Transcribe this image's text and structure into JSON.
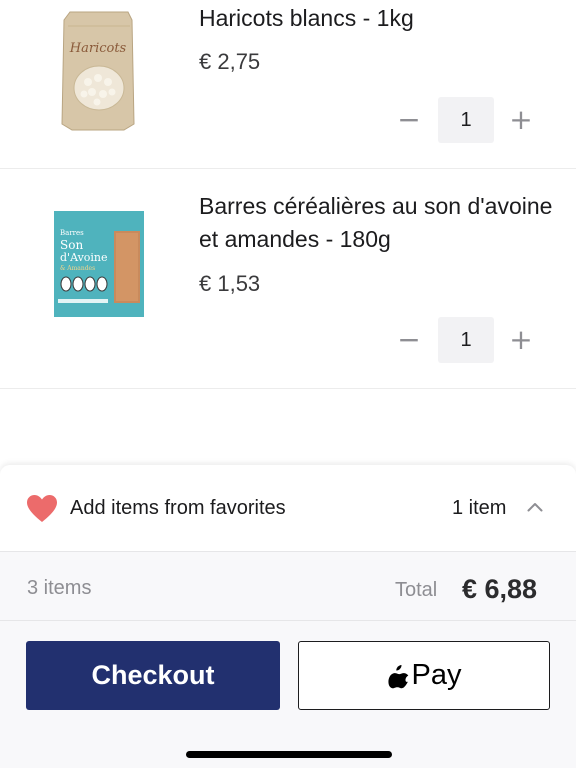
{
  "cart": {
    "items": [
      {
        "name": "Haricots blancs - 1kg",
        "price": "€ 2,75",
        "quantity": "1",
        "minus_symbol": "−",
        "plus_symbol": "+"
      },
      {
        "name": "Barres céréalières au son d'avoine et amandes - 180g",
        "price": "€ 1,53",
        "quantity": "1",
        "minus_symbol": "−",
        "plus_symbol": "+"
      }
    ]
  },
  "product_images": {
    "haricots_text": "Haricots",
    "barres_lines": [
      "Barres",
      "Son",
      "d'Avoine",
      "& Amandes"
    ]
  },
  "favorites": {
    "label": "Add items from favorites",
    "count": "1 item",
    "icon": "heart-icon",
    "heart_color": "#ec6b6b"
  },
  "summary": {
    "items_count": "3 items",
    "total_label": "Total",
    "total_value": "€ 6,88"
  },
  "actions": {
    "checkout_label": "Checkout",
    "applepay_label": "Pay"
  },
  "colors": {
    "accent": "#22306f"
  }
}
